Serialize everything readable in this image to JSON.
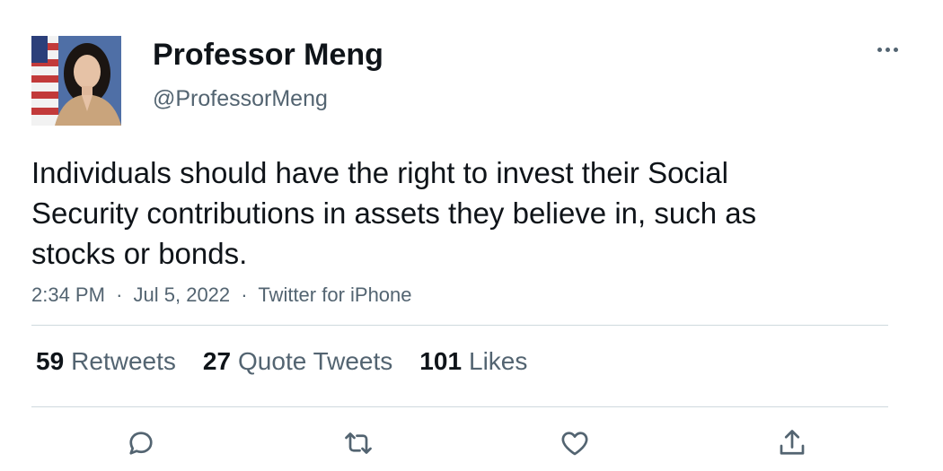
{
  "author": {
    "display_name": "Professor Meng",
    "handle": "@ProfessorMeng"
  },
  "tweet": {
    "text": "Individuals should have the right to invest their Social Security contributions in assets they believe in, such as stocks or bonds.",
    "time": "2:34 PM",
    "separator": "·",
    "date": "Jul 5, 2022",
    "source": "Twitter for iPhone"
  },
  "stats": {
    "retweets": {
      "count": "59",
      "label": "Retweets"
    },
    "quotes": {
      "count": "27",
      "label": "Quote Tweets"
    },
    "likes": {
      "count": "101",
      "label": "Likes"
    }
  },
  "actions": [
    {
      "icon": "reply-icon"
    },
    {
      "icon": "retweet-icon"
    },
    {
      "icon": "like-icon"
    },
    {
      "icon": "share-icon"
    }
  ],
  "colors": {
    "text_primary": "#0f1419",
    "text_secondary": "#536471",
    "divider": "#cfd9de"
  }
}
